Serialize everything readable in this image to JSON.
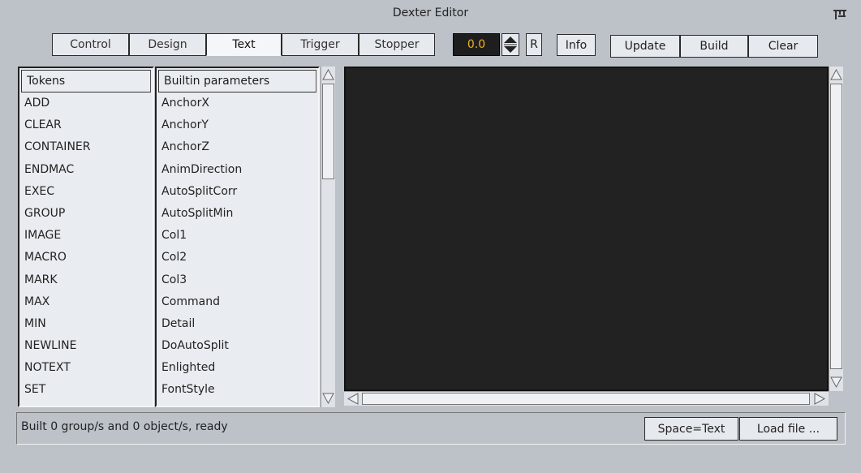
{
  "window": {
    "title": "Dexter Editor",
    "pin_icon": "pin-icon"
  },
  "tabs": [
    {
      "label": "Control",
      "active": false
    },
    {
      "label": "Design",
      "active": false
    },
    {
      "label": "Text",
      "active": true
    },
    {
      "label": "Trigger",
      "active": false
    },
    {
      "label": "Stopper",
      "active": false
    }
  ],
  "toolbar": {
    "value": "0.0",
    "spinner_icon": "spinner-arrows-icon",
    "reset_label": "R",
    "info_label": "Info",
    "update_label": "Update",
    "build_label": "Build",
    "clear_label": "Clear"
  },
  "tokens": {
    "header": "Tokens",
    "items": [
      "ADD",
      "CLEAR",
      "CONTAINER",
      "ENDMAC",
      "EXEC",
      "GROUP",
      "IMAGE",
      "MACRO",
      "MARK",
      "MAX",
      "MIN",
      "NEWLINE",
      "NOTEXT",
      "SET"
    ]
  },
  "builtin": {
    "header": "Builtin parameters",
    "items": [
      "AnchorX",
      "AnchorY",
      "AnchorZ",
      "AnimDirection",
      "AutoSplitCorr",
      "AutoSplitMin",
      "Col1",
      "Col2",
      "Col3",
      "Command",
      "Detail",
      "DoAutoSplit",
      "Enlighted",
      "FontStyle"
    ]
  },
  "status": {
    "text": "Built 0 group/s and 0 object/s, ready",
    "space_label": "Space=Text",
    "load_label": "Load file ..."
  },
  "colors": {
    "background": "#bdc2c9",
    "editor": "#222222",
    "value_text": "#f0b020",
    "active_tab": "#f4f6f9"
  }
}
